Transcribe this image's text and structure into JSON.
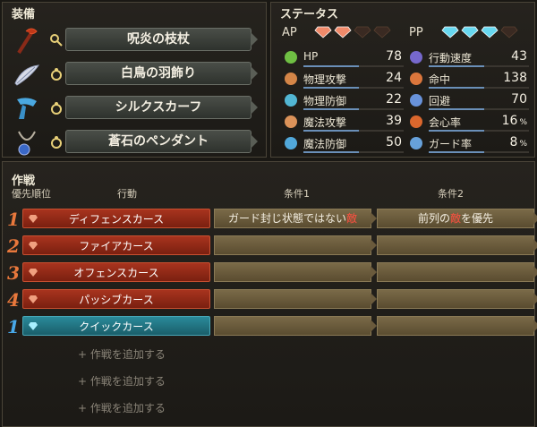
{
  "equip": {
    "title": "装備",
    "items": [
      {
        "name": "呪炎の枝杖",
        "slot_icon": "staff-slot-icon",
        "item_icon": "staff-icon"
      },
      {
        "name": "白鳥の羽飾り",
        "slot_icon": "ring-slot-icon",
        "item_icon": "feather-icon"
      },
      {
        "name": "シルクスカーフ",
        "slot_icon": "ring-slot-icon",
        "item_icon": "scarf-icon"
      },
      {
        "name": "蒼石のペンダント",
        "slot_icon": "ring-slot-icon",
        "item_icon": "pendant-icon"
      }
    ]
  },
  "status": {
    "title": "ステータス",
    "ap_label": "AP",
    "ap_current": 2,
    "ap_max": 4,
    "pp_label": "PP",
    "pp_current": 3,
    "pp_max": 4,
    "left": [
      {
        "name": "HP",
        "value": "78",
        "icon": "heart-icon",
        "color": "#78d048"
      },
      {
        "name": "物理攻撃",
        "value": "24",
        "icon": "sword-icon",
        "color": "#e8904c"
      },
      {
        "name": "物理防御",
        "value": "22",
        "icon": "armor-icon",
        "color": "#58c8e8"
      },
      {
        "name": "魔法攻撃",
        "value": "39",
        "icon": "wand-icon",
        "color": "#f0a060"
      },
      {
        "name": "魔法防御",
        "value": "50",
        "icon": "magic-shield-icon",
        "color": "#58b8f0"
      }
    ],
    "right": [
      {
        "name": "行動速度",
        "value": "43",
        "unit": "",
        "icon": "speed-icon",
        "color": "#8070e0"
      },
      {
        "name": "命中",
        "value": "138",
        "unit": "",
        "icon": "target-icon",
        "color": "#f08040"
      },
      {
        "name": "回避",
        "value": "70",
        "unit": "",
        "icon": "evade-icon",
        "color": "#70a0f0"
      },
      {
        "name": "会心率",
        "value": "16",
        "unit": "%",
        "icon": "critical-icon",
        "color": "#f07030"
      },
      {
        "name": "ガード率",
        "value": "8",
        "unit": "%",
        "icon": "guard-icon",
        "color": "#70b0f0"
      }
    ]
  },
  "tactics": {
    "title": "作戦",
    "headers": {
      "priority": "優先順位",
      "action": "行動",
      "cond1": "条件1",
      "cond2": "条件2"
    },
    "rows": [
      {
        "num": "1",
        "type": "red",
        "action": "ディフェンスカース",
        "cond1_pre": "ガード封じ状態ではない",
        "cond1_enemy": "敵",
        "cond1_post": "",
        "cond2_pre": "前列の",
        "cond2_enemy": "敵",
        "cond2_post": "を優先"
      },
      {
        "num": "2",
        "type": "red",
        "action": "ファイアカース",
        "cond1_pre": "",
        "cond1_enemy": "",
        "cond1_post": "",
        "cond2_pre": "",
        "cond2_enemy": "",
        "cond2_post": ""
      },
      {
        "num": "3",
        "type": "red",
        "action": "オフェンスカース",
        "cond1_pre": "",
        "cond1_enemy": "",
        "cond1_post": "",
        "cond2_pre": "",
        "cond2_enemy": "",
        "cond2_post": ""
      },
      {
        "num": "4",
        "type": "red",
        "action": "パッシブカース",
        "cond1_pre": "",
        "cond1_enemy": "",
        "cond1_post": "",
        "cond2_pre": "",
        "cond2_enemy": "",
        "cond2_post": ""
      },
      {
        "num": "1",
        "type": "teal",
        "action": "クイックカース",
        "cond1_pre": "",
        "cond1_enemy": "",
        "cond1_post": "",
        "cond2_pre": "",
        "cond2_enemy": "",
        "cond2_post": ""
      }
    ],
    "add_label": "+ 作戦を追加する"
  }
}
